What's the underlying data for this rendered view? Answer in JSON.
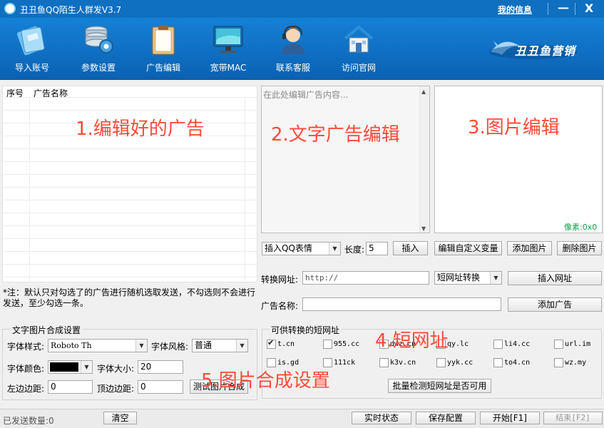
{
  "window": {
    "title": "丑丑鱼QQ陌生人群发V3.7",
    "my_info": "我的信息",
    "minimize": "—",
    "close": "X"
  },
  "toolbar": {
    "items": [
      {
        "label": "导入账号",
        "icon": "folder-icon"
      },
      {
        "label": "参数设置",
        "icon": "settings-database-icon"
      },
      {
        "label": "广告编辑",
        "icon": "clipboard-icon"
      },
      {
        "label": "宽带MAC",
        "icon": "monitor-icon"
      },
      {
        "label": "联系客服",
        "icon": "customer-service-icon"
      },
      {
        "label": "访问官网",
        "icon": "home-icon"
      }
    ],
    "brand": "丑丑鱼营销"
  },
  "ad_list": {
    "columns": [
      "序号",
      "广告名称"
    ],
    "rows": [],
    "annotation": "1.编辑好的广告",
    "note": "*注：默认只对勾选了的广告进行随机选取发送，不勾选则不会进行发送，至少勾选一条。"
  },
  "text_editor": {
    "placeholder": "在此处编辑广告内容...",
    "annotation": "2.文字广告编辑"
  },
  "image_editor": {
    "annotation": "3.图片编辑",
    "pixel_label": "像素:0x0"
  },
  "controls": {
    "emoji_select": "插入QQ表情",
    "length_label": "长度:",
    "length_value": "5",
    "insert": "插入",
    "edit_custom_var": "编辑自定义变量",
    "add_image": "添加图片",
    "delete_image": "删除图片",
    "convert_url_label": "转换网址:",
    "convert_url_value": "http://",
    "short_url_select": "短网址转换",
    "insert_url": "插入网址",
    "ad_name_label": "广告名称:",
    "ad_name_value": "",
    "add_ad": "添加广告"
  },
  "text_image": {
    "title": "文字图片合成设置",
    "font_style_label": "字体样式:",
    "font_style_value": "Roboto Th",
    "font_weight_label": "字体风格:",
    "font_weight_value": "普通",
    "font_color_label": "字体颜色:",
    "font_color": "#000000",
    "font_size_label": "字体大小:",
    "font_size_value": "20",
    "left_margin_label": "左边边距:",
    "left_margin_value": "0",
    "top_margin_label": "顶边边距:",
    "top_margin_value": "0",
    "test_button": "测试图片合成",
    "annotation": "5.图片合成设置"
  },
  "short_urls": {
    "title": "可供转换的短网址",
    "items": [
      {
        "label": "t.cn",
        "checked": true
      },
      {
        "label": "955.cc",
        "checked": false
      },
      {
        "label": "dwz.cn",
        "checked": false
      },
      {
        "label": "qy.lc",
        "checked": false
      },
      {
        "label": "li4.cc",
        "checked": false
      },
      {
        "label": "url.im",
        "checked": false
      },
      {
        "label": "is.gd",
        "checked": false
      },
      {
        "label": "111ck",
        "checked": false
      },
      {
        "label": "k3v.cn",
        "checked": false
      },
      {
        "label": "yyk.cc",
        "checked": false
      },
      {
        "label": "to4.cn",
        "checked": false
      },
      {
        "label": "wz.my",
        "checked": false
      }
    ],
    "batch_check": "批量检测短网址是否可用",
    "annotation": "4.短网址"
  },
  "status": {
    "sent_label": "已发送数量:",
    "sent_count": "0",
    "clear": "清空",
    "realtime": "实时状态",
    "save_config": "保存配置",
    "start": "开始[F1]",
    "end": "结束[F2]"
  }
}
